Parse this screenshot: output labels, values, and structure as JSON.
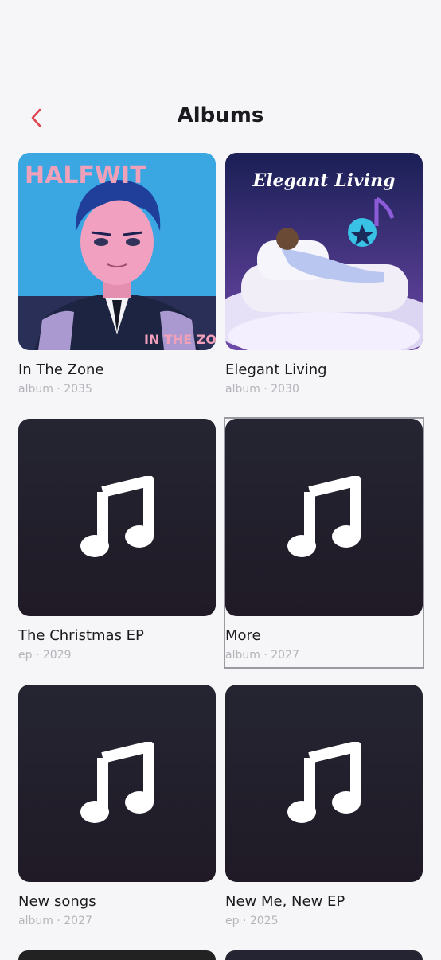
{
  "header": {
    "title": "Albums",
    "back_icon": "chevron-left-icon",
    "accent": "#e0454e"
  },
  "albums": [
    {
      "title": "In The Zone",
      "meta": "album · 2035",
      "art": "cover-halfwit",
      "art_text_top": "HALFWIT",
      "art_text_bottom": "IN THE ZONE"
    },
    {
      "title": "Elegant Living",
      "meta": "album · 2030",
      "art": "cover-elegant",
      "art_text_top": "Elegant Living"
    },
    {
      "title": "The Christmas EP",
      "meta": "ep · 2029",
      "art": "music-note-icon"
    },
    {
      "title": "More",
      "meta": "album · 2027",
      "art": "music-note-icon"
    },
    {
      "title": "New songs",
      "meta": "album · 2027",
      "art": "music-note-icon"
    },
    {
      "title": "New Me, New EP",
      "meta": "ep · 2025",
      "art": "music-note-icon"
    }
  ]
}
